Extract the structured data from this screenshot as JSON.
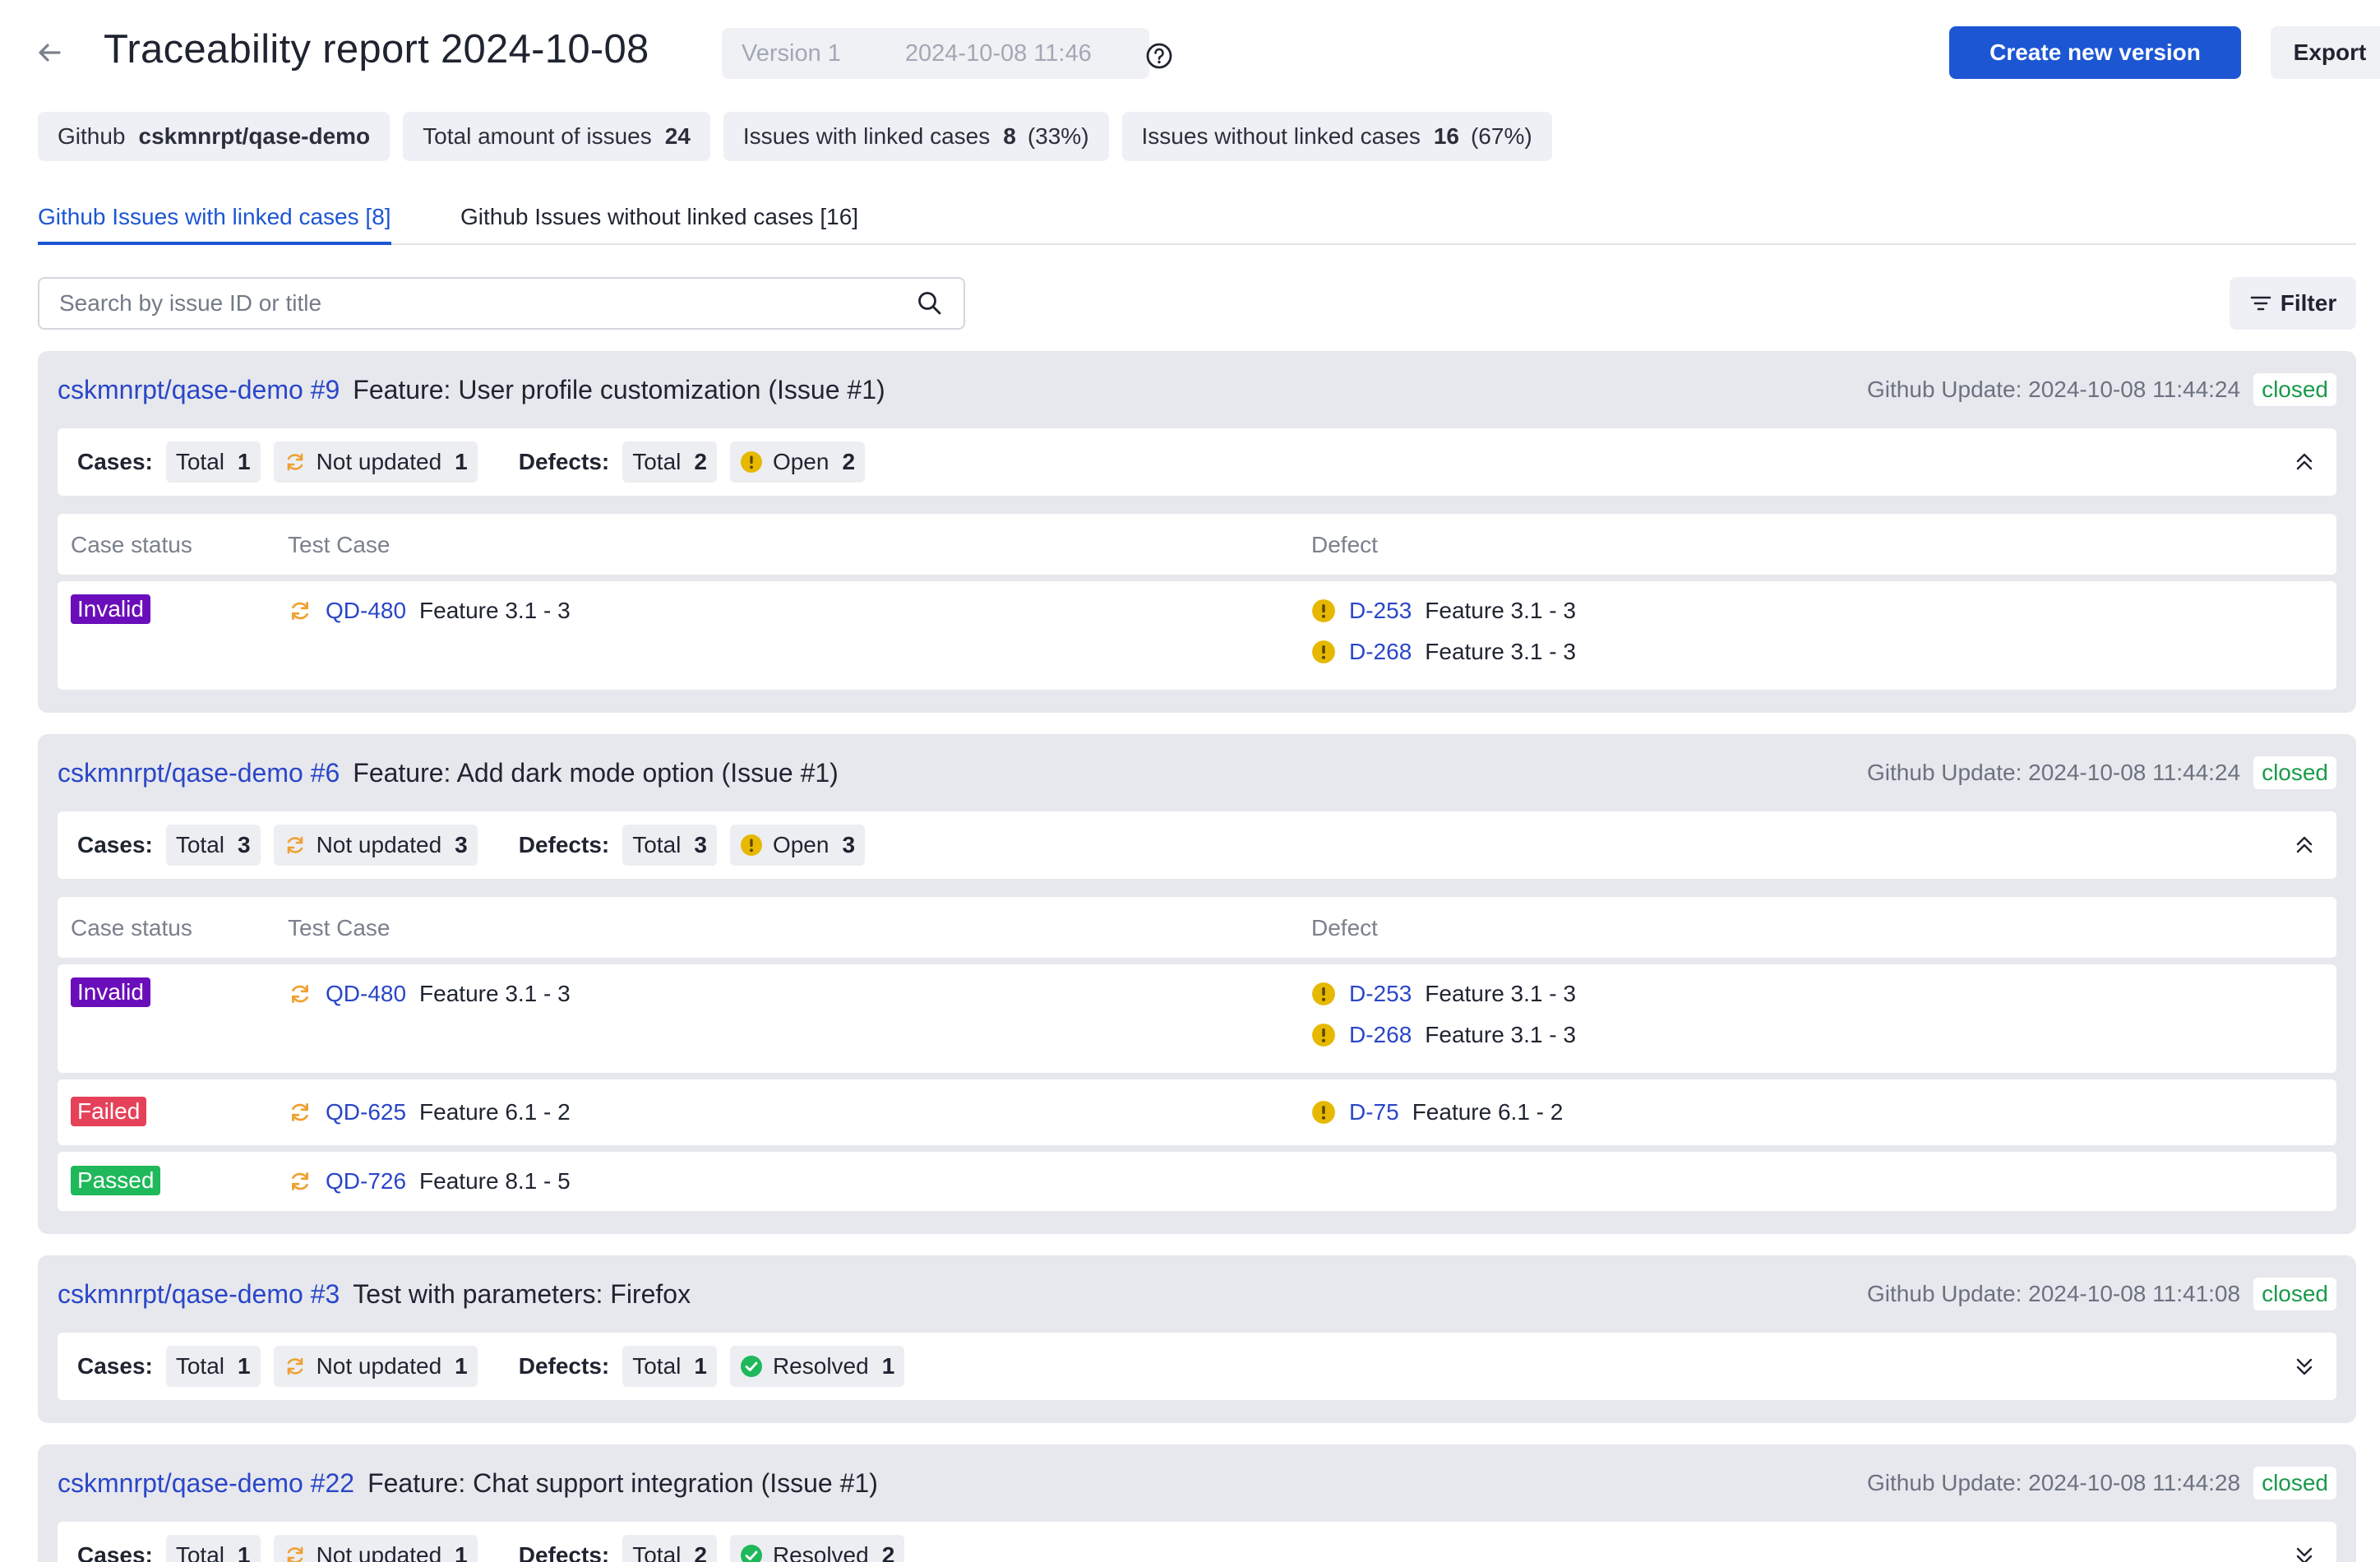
{
  "header": {
    "title": "Traceability report 2024-10-08",
    "version_label": "Version 1",
    "version_date": "2024-10-08 11:46",
    "create_button": "Create new version",
    "export_button": "Export"
  },
  "stats": {
    "github_label": "Github",
    "github_repo": "cskmnrpt/qase-demo",
    "total_label": "Total amount of issues",
    "total_value": "24",
    "linked_label": "Issues with linked cases",
    "linked_value": "8",
    "linked_pct": "(33%)",
    "unlinked_label": "Issues without linked cases",
    "unlinked_value": "16",
    "unlinked_pct": "(67%)"
  },
  "tabs": {
    "linked": "Github Issues with linked cases [8]",
    "unlinked": "Github Issues without linked cases [16]"
  },
  "search": {
    "placeholder": "Search by issue ID or title"
  },
  "filter": {
    "label": "Filter"
  },
  "labels": {
    "cases": "Cases:",
    "defects": "Defects:",
    "total": "Total",
    "not_updated": "Not updated",
    "open": "Open",
    "resolved": "Resolved",
    "github_update": "Github Update:",
    "col_status": "Case status",
    "col_case": "Test Case",
    "col_defect": "Defect"
  },
  "issues": [
    {
      "id": "cskmnrpt/qase-demo #9",
      "title": "Feature: User profile customization (Issue #1)",
      "updated": "2024-10-08 11:44:24",
      "state": "closed",
      "cases_total": "1",
      "cases_not_updated": "1",
      "defects_total": "2",
      "defects_open": "2",
      "rows": [
        {
          "status": "Invalid",
          "case_id": "QD-480",
          "case_title": "Feature 3.1 - 3",
          "defects": [
            {
              "id": "D-253",
              "title": "Feature 3.1 - 3"
            },
            {
              "id": "D-268",
              "title": "Feature 3.1 - 3"
            }
          ]
        }
      ]
    },
    {
      "id": "cskmnrpt/qase-demo #6",
      "title": "Feature: Add dark mode option (Issue #1)",
      "updated": "2024-10-08 11:44:24",
      "state": "closed",
      "cases_total": "3",
      "cases_not_updated": "3",
      "defects_total": "3",
      "defects_open": "3",
      "rows": [
        {
          "status": "Invalid",
          "case_id": "QD-480",
          "case_title": "Feature 3.1 - 3",
          "defects": [
            {
              "id": "D-253",
              "title": "Feature 3.1 - 3"
            },
            {
              "id": "D-268",
              "title": "Feature 3.1 - 3"
            }
          ]
        },
        {
          "status": "Failed",
          "case_id": "QD-625",
          "case_title": "Feature 6.1 - 2",
          "defects": [
            {
              "id": "D-75",
              "title": "Feature 6.1 - 2"
            }
          ]
        },
        {
          "status": "Passed",
          "case_id": "QD-726",
          "case_title": "Feature 8.1 - 5",
          "defects": []
        }
      ]
    },
    {
      "id": "cskmnrpt/qase-demo #3",
      "title": "Test with parameters: Firefox",
      "updated": "2024-10-08 11:41:08",
      "state": "closed",
      "cases_total": "1",
      "cases_not_updated": "1",
      "defects_total": "1",
      "defects_resolved": "1"
    },
    {
      "id": "cskmnrpt/qase-demo #22",
      "title": "Feature: Chat support integration (Issue #1)",
      "updated": "2024-10-08 11:44:28",
      "state": "closed",
      "cases_total": "1",
      "cases_not_updated": "1",
      "defects_total": "2",
      "defects_resolved": "2"
    }
  ],
  "colors": {
    "primary": "#1c56d3",
    "link": "#2a46c8",
    "invalid": "#6a0dba",
    "failed": "#e5425a",
    "passed": "#1fb85a",
    "open": "#e6b800",
    "not_updated": "#f0a030",
    "closed_text": "#1a9a4a"
  }
}
